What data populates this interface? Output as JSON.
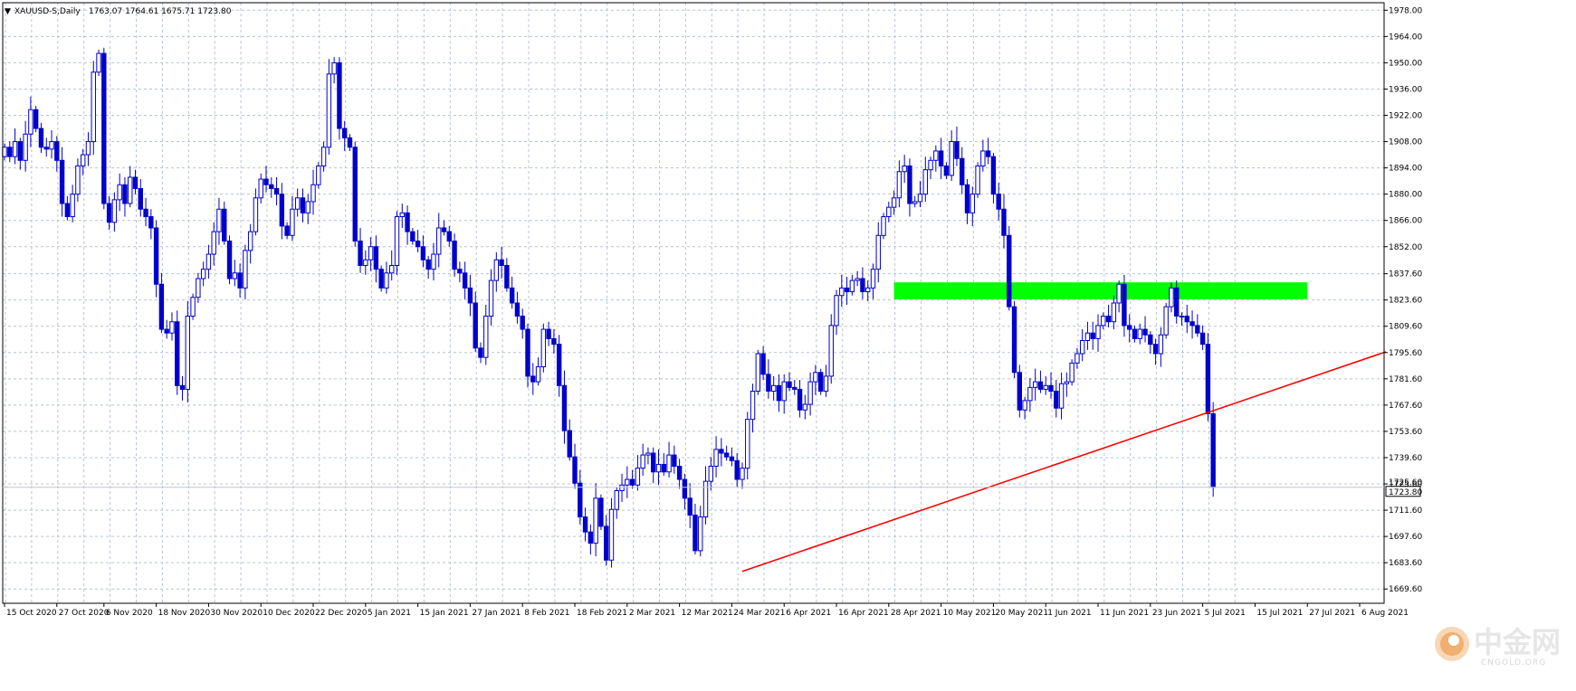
{
  "header": {
    "symbol": "XAUUSD-S,Daily",
    "values": "1763.07 1764.61 1675.71 1723.80"
  },
  "colors": {
    "candle": "#0000cc",
    "grid": "#b8c4d4",
    "trendline": "#ff0000",
    "zone": "#00ff00",
    "price_line": "#c0c8d0",
    "background": "#ffffff"
  },
  "watermark": {
    "name": "中金网",
    "domain": "CNGOLD.ORG",
    "icon": "coin-logo-icon"
  },
  "chart_data": {
    "type": "candlestick",
    "title": "",
    "ylim": [
      1662,
      1982
    ],
    "grid": true,
    "y_ticks": [
      "1978.00",
      "1964.00",
      "1950.00",
      "1936.00",
      "1922.00",
      "1908.00",
      "1894.00",
      "1880.00",
      "1866.00",
      "1852.00",
      "1837.60",
      "1823.60",
      "1809.60",
      "1795.60",
      "1781.60",
      "1767.60",
      "1753.60",
      "1739.60",
      "1725.60",
      "1711.60",
      "1697.60",
      "1683.60",
      "1669.60"
    ],
    "x_ticks": [
      {
        "i": 0,
        "label": "15 Oct 2020"
      },
      {
        "i": 10,
        "label": "27 Oct 2020"
      },
      {
        "i": 19,
        "label": "6 Nov 2020"
      },
      {
        "i": 29,
        "label": "18 Nov 2020"
      },
      {
        "i": 39,
        "label": "30 Nov 2020"
      },
      {
        "i": 49,
        "label": "10 Dec 2020"
      },
      {
        "i": 59,
        "label": "22 Dec 2020"
      },
      {
        "i": 69,
        "label": "5 Jan 2021"
      },
      {
        "i": 79,
        "label": "15 Jan 2021"
      },
      {
        "i": 89,
        "label": "27 Jan 2021"
      },
      {
        "i": 99,
        "label": "8 Feb 2021"
      },
      {
        "i": 109,
        "label": "18 Feb 2021"
      },
      {
        "i": 119,
        "label": "2 Mar 2021"
      },
      {
        "i": 129,
        "label": "12 Mar 2021"
      },
      {
        "i": 139,
        "label": "24 Mar 2021"
      },
      {
        "i": 149,
        "label": "6 Apr 2021"
      },
      {
        "i": 159,
        "label": "16 Apr 2021"
      },
      {
        "i": 169,
        "label": "28 Apr 2021"
      },
      {
        "i": 179,
        "label": "10 May 2021"
      },
      {
        "i": 189,
        "label": "20 May 2021"
      },
      {
        "i": 199,
        "label": "1 Jun 2021"
      },
      {
        "i": 209,
        "label": "11 Jun 2021"
      },
      {
        "i": 219,
        "label": "23 Jun 2021"
      },
      {
        "i": 229,
        "label": "5 Jul 2021"
      },
      {
        "i": 239,
        "label": "15 Jul 2021"
      },
      {
        "i": 249,
        "label": "27 Jul 2021"
      },
      {
        "i": 259,
        "label": "6 Aug 2021"
      }
    ],
    "close_series": [
      1905,
      1900,
      1908,
      1898,
      1912,
      1925,
      1915,
      1905,
      1904,
      1908,
      1898,
      1875,
      1868,
      1880,
      1895,
      1901,
      1908,
      1945,
      1955,
      1875,
      1865,
      1877,
      1885,
      1875,
      1889,
      1883,
      1872,
      1868,
      1862,
      1832,
      1808,
      1806,
      1812,
      1778,
      1776,
      1815,
      1825,
      1835,
      1840,
      1848,
      1860,
      1872,
      1855,
      1835,
      1838,
      1830,
      1850,
      1860,
      1878,
      1888,
      1885,
      1883,
      1880,
      1863,
      1858,
      1872,
      1878,
      1870,
      1876,
      1885,
      1895,
      1905,
      1944,
      1950,
      1915,
      1910,
      1905,
      1855,
      1842,
      1845,
      1852,
      1840,
      1830,
      1838,
      1842,
      1868,
      1870,
      1860,
      1855,
      1852,
      1845,
      1840,
      1848,
      1862,
      1860,
      1855,
      1840,
      1838,
      1830,
      1822,
      1798,
      1793,
      1815,
      1834,
      1845,
      1842,
      1830,
      1822,
      1815,
      1808,
      1783,
      1780,
      1788,
      1808,
      1803,
      1800,
      1778,
      1754,
      1740,
      1726,
      1708,
      1700,
      1694,
      1718,
      1703,
      1685,
      1712,
      1722,
      1725,
      1728,
      1725,
      1734,
      1741,
      1742,
      1732,
      1736,
      1732,
      1741,
      1735,
      1728,
      1718,
      1709,
      1690,
      1708,
      1727,
      1735,
      1744,
      1742,
      1740,
      1738,
      1728,
      1734,
      1760,
      1775,
      1795,
      1784,
      1775,
      1778,
      1770,
      1780,
      1777,
      1776,
      1765,
      1768,
      1780,
      1785,
      1775,
      1783,
      1810,
      1826,
      1830,
      1828,
      1834,
      1835,
      1828,
      1830,
      1840,
      1858,
      1868,
      1873,
      1878,
      1892,
      1895,
      1875,
      1876,
      1880,
      1893,
      1898,
      1903,
      1895,
      1890,
      1908,
      1899,
      1885,
      1870,
      1880,
      1895,
      1903,
      1900,
      1880,
      1872,
      1858,
      1820,
      1785,
      1765,
      1770,
      1777,
      1780,
      1776,
      1778,
      1775,
      1766,
      1779,
      1780,
      1790,
      1795,
      1802,
      1806,
      1803,
      1810,
      1815,
      1812,
      1822,
      1832,
      1810,
      1808,
      1803,
      1808,
      1805,
      1800,
      1795,
      1805,
      1820,
      1830,
      1815,
      1815,
      1812,
      1810,
      1806,
      1800,
      1763,
      1723.8
    ],
    "trendline": {
      "from": {
        "i": 141,
        "price": 1679
      },
      "to": {
        "i": 264,
        "price": 1796
      }
    },
    "resistance_zone": {
      "from_i": 170,
      "to_i": 249,
      "price_low": 1824,
      "price_high": 1833
    },
    "last_price": "1723.80",
    "right_edge_tick_label": "1725.60",
    "timeframe_arrow": "▼"
  }
}
